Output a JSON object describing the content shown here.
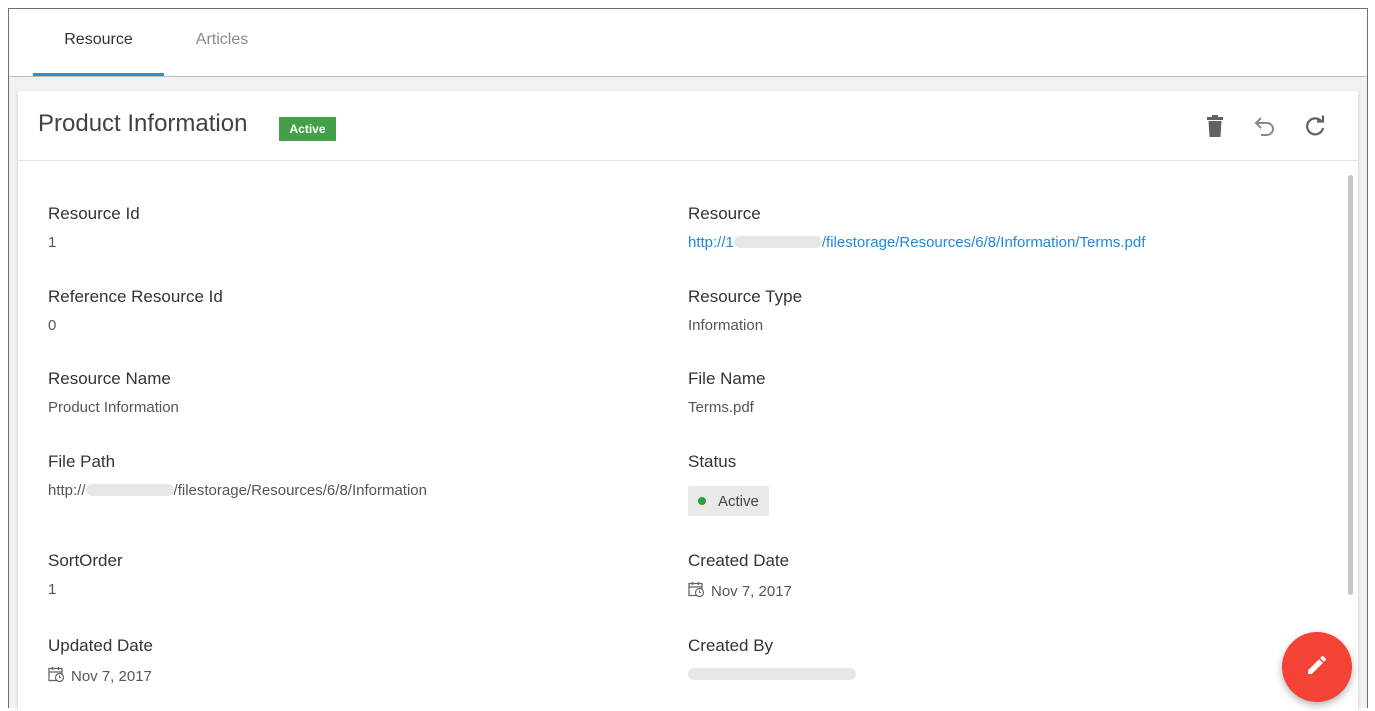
{
  "tabs": [
    {
      "label": "Resource",
      "active": true
    },
    {
      "label": "Articles",
      "active": false
    }
  ],
  "card": {
    "title": "Product Information",
    "badge": "Active",
    "actions": [
      "trash-icon",
      "undo-icon",
      "refresh-icon"
    ]
  },
  "fields": {
    "resource_id": {
      "label": "Resource Id",
      "value": "1"
    },
    "reference_resource_id": {
      "label": "Reference Resource Id",
      "value": "0"
    },
    "resource_name": {
      "label": "Resource Name",
      "value": "Product Information"
    },
    "file_path": {
      "label": "File Path",
      "prefix": "http://",
      "suffix": "/filestorage/Resources/6/8/Information"
    },
    "sort_order": {
      "label": "SortOrder",
      "value": "1"
    },
    "updated_date": {
      "label": "Updated Date",
      "value": "Nov 7, 2017"
    },
    "resource": {
      "label": "Resource",
      "prefix": "http://1",
      "suffix": "/filestorage/Resources/6/8/Information/Terms.pdf"
    },
    "resource_type": {
      "label": "Resource Type",
      "value": "Information"
    },
    "file_name": {
      "label": "File Name",
      "value": "Terms.pdf"
    },
    "status": {
      "label": "Status",
      "value": "Active"
    },
    "created_date": {
      "label": "Created Date",
      "value": "Nov 7, 2017"
    },
    "created_by": {
      "label": "Created By"
    }
  },
  "colors": {
    "tab_indicator": "#2196d3",
    "badge": "#43a047",
    "link": "#1e88e5",
    "status_dot": "#2e9e3e",
    "fab": "#f44336"
  }
}
